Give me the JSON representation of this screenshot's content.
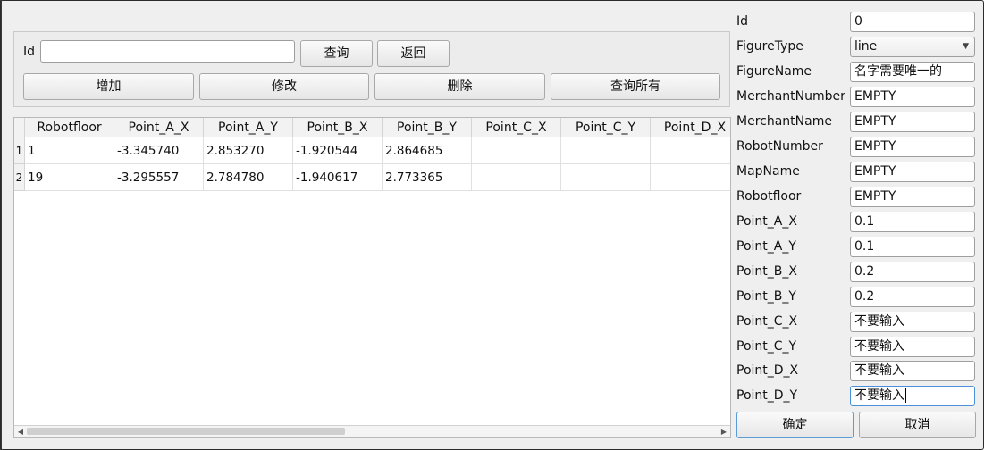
{
  "query": {
    "id_label": "Id",
    "id_value": "",
    "query_label": "查询",
    "back_label": "返回",
    "add_label": "增加",
    "edit_label": "修改",
    "delete_label": "删除",
    "query_all_label": "查询所有"
  },
  "table": {
    "headers": [
      "Robotfloor",
      "Point_A_X",
      "Point_A_Y",
      "Point_B_X",
      "Point_B_Y",
      "Point_C_X",
      "Point_C_Y",
      "Point_D_X"
    ],
    "rows": [
      {
        "num": "1",
        "cells": [
          "1",
          "-3.345740",
          "2.853270",
          "-1.920544",
          "2.864685",
          "",
          "",
          ""
        ]
      },
      {
        "num": "2",
        "cells": [
          "19",
          "-3.295557",
          "2.784780",
          "-1.940617",
          "2.773365",
          "",
          "",
          ""
        ]
      }
    ],
    "scroll_left_icon": "chevron-left-icon",
    "scroll_right_icon": "chevron-right-icon"
  },
  "form": {
    "fields": [
      {
        "label": "Id",
        "value": "0"
      },
      {
        "label": "FigureType",
        "value": "line"
      },
      {
        "label": "FigureName",
        "value": "名字需要唯一的"
      },
      {
        "label": "MerchantNumber",
        "value": "EMPTY"
      },
      {
        "label": "MerchantName",
        "value": "EMPTY"
      },
      {
        "label": "RobotNumber",
        "value": "EMPTY"
      },
      {
        "label": "MapName",
        "value": "EMPTY"
      },
      {
        "label": "Robotfloor",
        "value": "EMPTY"
      },
      {
        "label": "Point_A_X",
        "value": "0.1"
      },
      {
        "label": "Point_A_Y",
        "value": "0.1"
      },
      {
        "label": "Point_B_X",
        "value": "0.2"
      },
      {
        "label": "Point_B_Y",
        "value": "0.2"
      },
      {
        "label": "Point_C_X",
        "value": "不要输入"
      },
      {
        "label": "Point_C_Y",
        "value": "不要输入"
      },
      {
        "label": "Point_D_X",
        "value": "不要输入"
      },
      {
        "label": "Point_D_Y",
        "value": "不要输入"
      }
    ],
    "confirm_label": "确定",
    "cancel_label": "取消",
    "combo_icon": "chevron-down-icon"
  }
}
